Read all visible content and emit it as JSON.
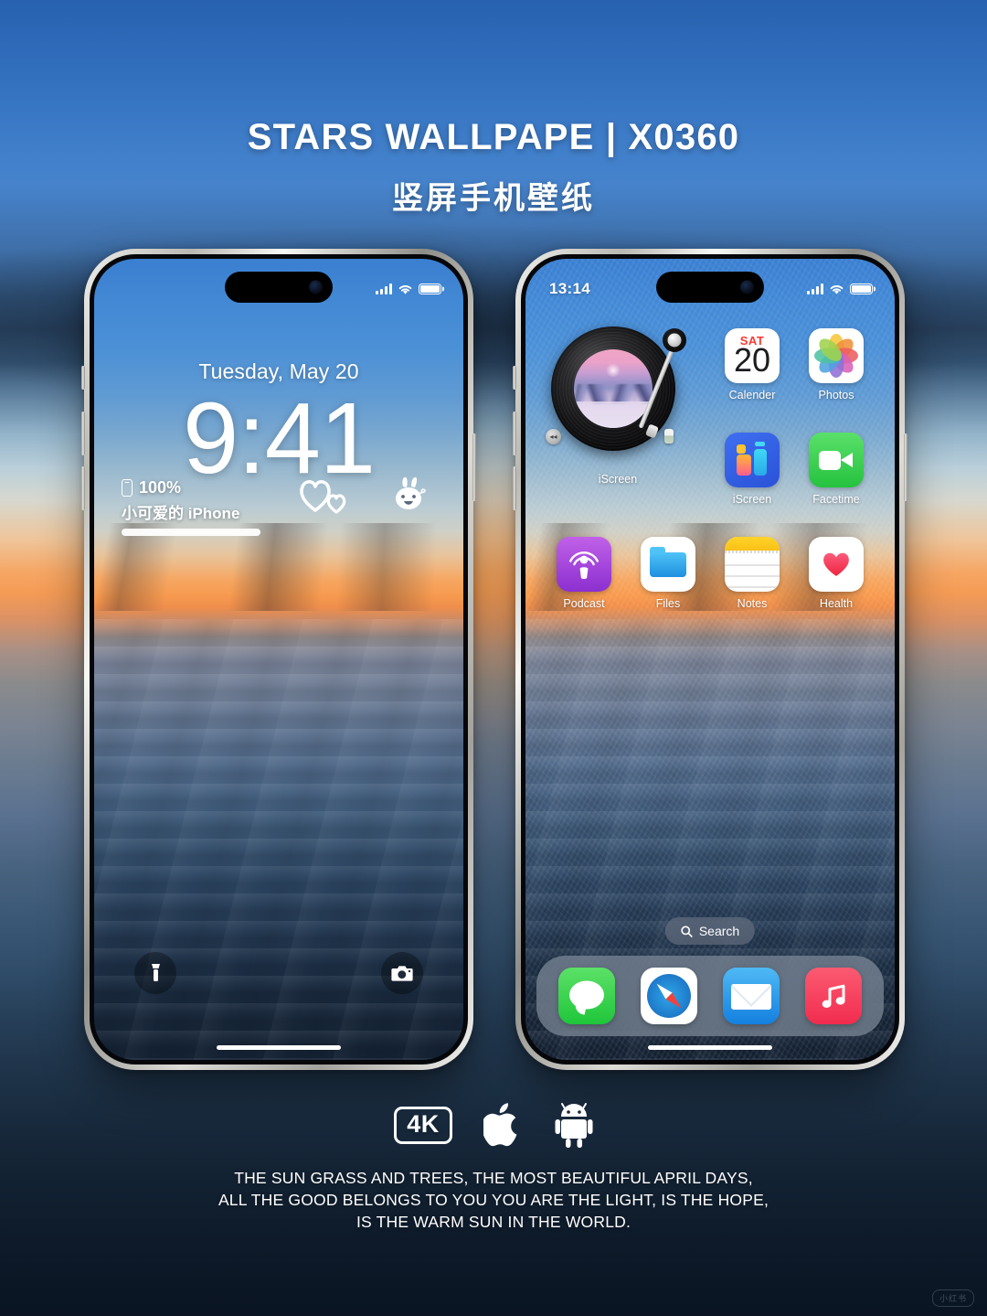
{
  "header": {
    "title": "STARS WALLPAPE | X0360",
    "subtitle": "竖屏手机壁纸"
  },
  "lock_screen": {
    "status_bar": {
      "time": "",
      "signal_icon": "cellular-signal-icon",
      "wifi_icon": "wifi-icon",
      "battery_icon": "battery-full-icon"
    },
    "date": "Tuesday, May 20",
    "time": "9:41",
    "battery_widget": {
      "percent": "100%",
      "device_name": "小可爱的 iPhone",
      "phone_icon": "iphone-icon"
    },
    "stickers": [
      {
        "name": "hearts-sticker"
      },
      {
        "name": "bunny-sticker"
      }
    ],
    "bottom_buttons": [
      {
        "name": "flashlight-button",
        "icon": "flashlight-icon"
      },
      {
        "name": "camera-button",
        "icon": "camera-icon"
      }
    ]
  },
  "home_screen": {
    "status_bar": {
      "time": "13:14",
      "signal_icon": "cellular-signal-icon",
      "wifi_icon": "wifi-icon",
      "battery_icon": "battery-full-icon"
    },
    "widget": {
      "label": "iScreen",
      "type": "turntable-widget",
      "left_control_icon": "rewind-icon",
      "right_control_icon": "slider-icon"
    },
    "apps": [
      {
        "label": "Calender",
        "icon": "calendar-icon",
        "day_of_week": "SAT",
        "day_number": "20"
      },
      {
        "label": "Photos",
        "icon": "photos-icon"
      },
      {
        "label": "iScreen",
        "icon": "iscreen-icon"
      },
      {
        "label": "Facetime",
        "icon": "facetime-icon"
      },
      {
        "label": "Podcast",
        "icon": "podcast-icon"
      },
      {
        "label": "Files",
        "icon": "files-icon"
      },
      {
        "label": "Notes",
        "icon": "notes-icon"
      },
      {
        "label": "Health",
        "icon": "health-icon"
      }
    ],
    "search": {
      "label": "Search",
      "icon": "search-icon"
    },
    "dock": [
      {
        "label": "Messages",
        "icon": "messages-icon"
      },
      {
        "label": "Safari",
        "icon": "safari-icon"
      },
      {
        "label": "Mail",
        "icon": "mail-icon"
      },
      {
        "label": "Music",
        "icon": "music-icon"
      }
    ]
  },
  "badges": [
    {
      "label": "4K",
      "name": "resolution-badge"
    },
    {
      "label": "",
      "name": "apple-logo-icon"
    },
    {
      "label": "",
      "name": "android-logo-icon"
    }
  ],
  "caption": {
    "line1": "THE SUN GRASS AND TREES, THE MOST BEAUTIFUL APRIL DAYS,",
    "line2": "ALL THE GOOD BELONGS TO YOU YOU ARE THE LIGHT, IS THE HOPE,",
    "line3": "IS THE WARM SUN IN THE WORLD."
  },
  "watermark": "小红书",
  "colors": {
    "accent_blue": "#3a7fd0",
    "sunset_orange": "#f6a763",
    "deep_navy": "#142234",
    "calendar_red": "#fb3b30",
    "health_red": "#f4425c"
  }
}
